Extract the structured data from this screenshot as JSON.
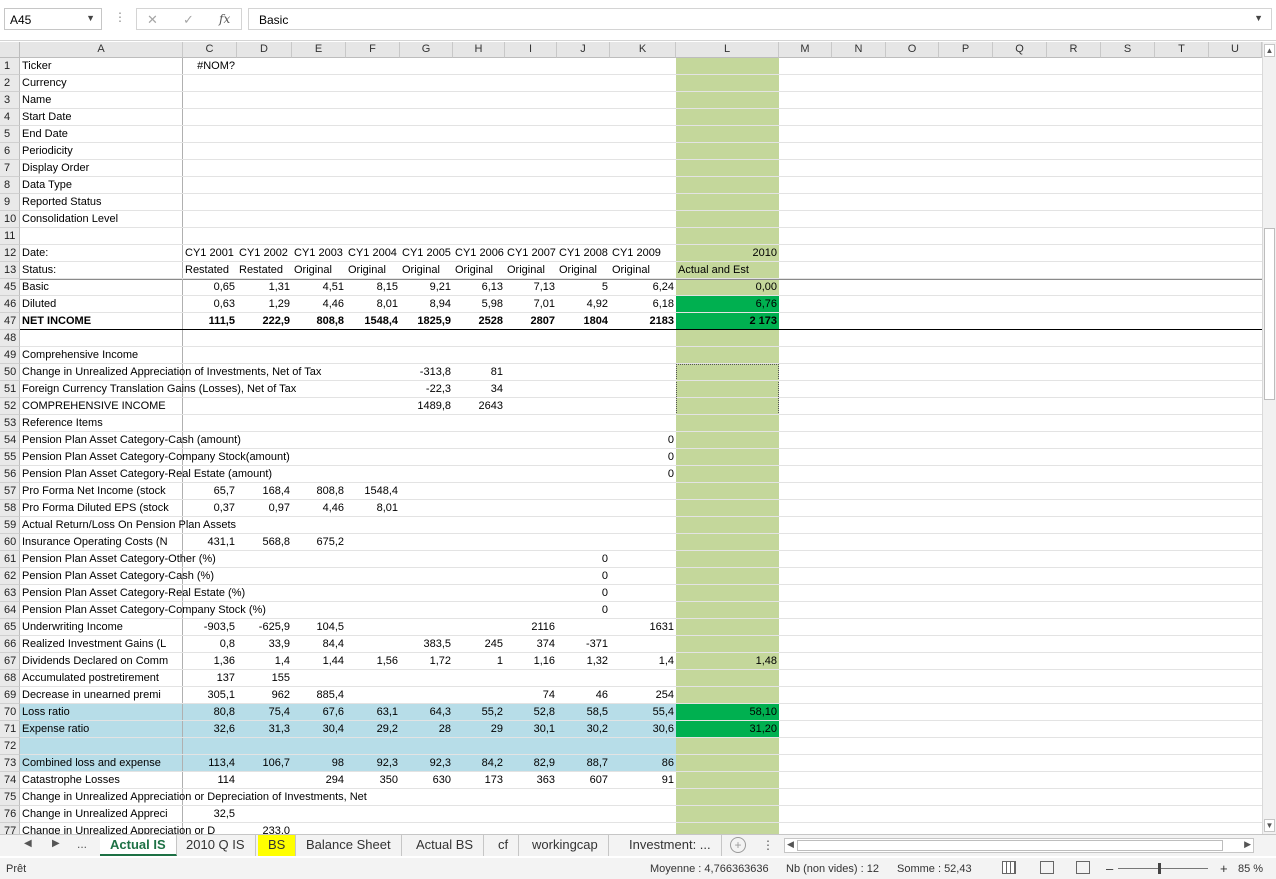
{
  "formula_bar": {
    "name_box": "A45",
    "content": "Basic",
    "fx": "fx",
    "cancel": "✕",
    "confirm": "✓"
  },
  "columns": [
    "A",
    "C",
    "D",
    "E",
    "F",
    "G",
    "H",
    "I",
    "J",
    "K",
    "L",
    "M",
    "N",
    "O",
    "P",
    "Q",
    "R",
    "S",
    "T",
    "U"
  ],
  "rows": [
    {
      "n": "1",
      "a": "Ticker",
      "cells": {
        "C": "#NOM?"
      }
    },
    {
      "n": "2",
      "a": "Currency",
      "cells": {}
    },
    {
      "n": "3",
      "a": "Name",
      "cells": {}
    },
    {
      "n": "4",
      "a": "Start Date",
      "cells": {}
    },
    {
      "n": "5",
      "a": "End Date",
      "cells": {}
    },
    {
      "n": "6",
      "a": "Periodicity",
      "cells": {}
    },
    {
      "n": "7",
      "a": "Display Order",
      "cells": {}
    },
    {
      "n": "8",
      "a": "Data Type",
      "cells": {}
    },
    {
      "n": "9",
      "a": "Reported Status",
      "cells": {}
    },
    {
      "n": "10",
      "a": "Consolidation Level",
      "cells": {}
    },
    {
      "n": "11",
      "a": "",
      "cells": {}
    },
    {
      "n": "12",
      "a": "Date:",
      "cells": {
        "C": "CY1 2001",
        "D": "CY1 2002",
        "E": "CY1 2003",
        "F": "CY1 2004",
        "G": "CY1 2005",
        "H": "CY1 2006",
        "I": "CY1 2007",
        "J": "CY1 2008",
        "K": "CY1 2009",
        "L": "2010"
      }
    },
    {
      "n": "13",
      "a": "Status:",
      "cells": {
        "C": "Restated",
        "D": "Restated",
        "E": "Original",
        "F": "Original",
        "G": "Original",
        "H": "Original",
        "I": "Original",
        "J": "Original",
        "K": "Original",
        "L": "Actual and Est"
      }
    },
    {
      "n": "45",
      "a": "Basic",
      "cells": {
        "C": "0,65",
        "D": "1,31",
        "E": "4,51",
        "F": "8,15",
        "G": "9,21",
        "H": "6,13",
        "I": "7,13",
        "J": "5",
        "K": "6,24",
        "L": "0,00"
      }
    },
    {
      "n": "46",
      "a": "Diluted",
      "cells": {
        "C": "0,63",
        "D": "1,29",
        "E": "4,46",
        "F": "8,01",
        "G": "8,94",
        "H": "5,98",
        "I": "7,01",
        "J": "4,92",
        "K": "6,18",
        "L": "6,76"
      }
    },
    {
      "n": "47",
      "a": "NET INCOME",
      "bold": true,
      "cells": {
        "C": "111,5",
        "D": "222,9",
        "E": "808,8",
        "F": "1548,4",
        "G": "1825,9",
        "H": "2528",
        "I": "2807",
        "J": "1804",
        "K": "2183",
        "L": "2 173"
      }
    },
    {
      "n": "48",
      "a": "",
      "cells": {}
    },
    {
      "n": "49",
      "a": "Comprehensive Income",
      "cells": {}
    },
    {
      "n": "50",
      "a": "Change in Unrealized Appreciation of Investments, Net of Tax",
      "cells": {
        "G": "-313,8",
        "H": "81"
      }
    },
    {
      "n": "51",
      "a": "Foreign Currency Translation Gains (Losses), Net of Tax",
      "cells": {
        "G": "-22,3",
        "H": "34"
      }
    },
    {
      "n": "52",
      "a": "COMPREHENSIVE INCOME",
      "cells": {
        "G": "1489,8",
        "H": "2643"
      }
    },
    {
      "n": "53",
      "a": "Reference Items",
      "cells": {}
    },
    {
      "n": "54",
      "a": "Pension Plan Asset Category-Cash (amount)",
      "cells": {
        "K": "0"
      }
    },
    {
      "n": "55",
      "a": "Pension Plan Asset Category-Company Stock(amount)",
      "cells": {
        "K": "0"
      }
    },
    {
      "n": "56",
      "a": "Pension Plan Asset Category-Real Estate (amount)",
      "cells": {
        "K": "0"
      }
    },
    {
      "n": "57",
      "a": "Pro Forma Net Income (stock",
      "cells": {
        "C": "65,7",
        "D": "168,4",
        "E": "808,8",
        "F": "1548,4"
      }
    },
    {
      "n": "58",
      "a": "Pro Forma Diluted EPS (stock",
      "cells": {
        "C": "0,37",
        "D": "0,97",
        "E": "4,46",
        "F": "8,01"
      }
    },
    {
      "n": "59",
      "a": "Actual Return/Loss On Pension Plan Assets",
      "cells": {}
    },
    {
      "n": "60",
      "a": "Insurance Operating Costs (N",
      "cells": {
        "C": "431,1",
        "D": "568,8",
        "E": "675,2"
      }
    },
    {
      "n": "61",
      "a": "Pension Plan Asset Category-Other (%)",
      "cells": {
        "J": "0"
      }
    },
    {
      "n": "62",
      "a": "Pension Plan Asset Category-Cash (%)",
      "cells": {
        "J": "0"
      }
    },
    {
      "n": "63",
      "a": "Pension Plan Asset Category-Real Estate (%)",
      "cells": {
        "J": "0"
      }
    },
    {
      "n": "64",
      "a": "Pension Plan Asset Category-Company Stock (%)",
      "cells": {
        "J": "0"
      }
    },
    {
      "n": "65",
      "a": "Underwriting Income",
      "cells": {
        "C": "-903,5",
        "D": "-625,9",
        "E": "104,5",
        "I": "2116",
        "K": "1631"
      }
    },
    {
      "n": "66",
      "a": "Realized Investment Gains (L",
      "cells": {
        "C": "0,8",
        "D": "33,9",
        "E": "84,4",
        "G": "383,5",
        "H": "245",
        "I": "374",
        "J": "-371"
      }
    },
    {
      "n": "67",
      "a": "Dividends Declared on Comm",
      "cells": {
        "C": "1,36",
        "D": "1,4",
        "E": "1,44",
        "F": "1,56",
        "G": "1,72",
        "H": "1",
        "I": "1,16",
        "J": "1,32",
        "K": "1,4",
        "L": "1,48"
      }
    },
    {
      "n": "68",
      "a": "Accumulated postretirement",
      "cells": {
        "C": "137",
        "D": "155"
      }
    },
    {
      "n": "69",
      "a": "Decrease in unearned premi",
      "cells": {
        "C": "305,1",
        "D": "962",
        "E": "885,4",
        "I": "74",
        "J": "46",
        "K": "254"
      }
    },
    {
      "n": "70",
      "a": "Loss ratio",
      "cells": {
        "C": "80,8",
        "D": "75,4",
        "E": "67,6",
        "F": "63,1",
        "G": "64,3",
        "H": "55,2",
        "I": "52,8",
        "J": "58,5",
        "K": "55,4",
        "L": "58,10"
      }
    },
    {
      "n": "71",
      "a": "Expense ratio",
      "cells": {
        "C": "32,6",
        "D": "31,3",
        "E": "30,4",
        "F": "29,2",
        "G": "28",
        "H": "29",
        "I": "30,1",
        "J": "30,2",
        "K": "30,6",
        "L": "31,20"
      }
    },
    {
      "n": "72",
      "a": "",
      "cells": {}
    },
    {
      "n": "73",
      "a": "Combined loss and expense",
      "cells": {
        "C": "113,4",
        "D": "106,7",
        "E": "98",
        "F": "92,3",
        "G": "92,3",
        "H": "84,2",
        "I": "82,9",
        "J": "88,7",
        "K": "86"
      }
    },
    {
      "n": "74",
      "a": "Catastrophe Losses",
      "cells": {
        "C": "114",
        "E": "294",
        "F": "350",
        "G": "630",
        "H": "173",
        "I": "363",
        "J": "607",
        "K": "91"
      }
    },
    {
      "n": "75",
      "a": "Change in Unrealized Appreciation or Depreciation of Investments, Net",
      "cells": {}
    },
    {
      "n": "76",
      "a": "Change in Unrealized Appreci",
      "cells": {
        "C": "32,5"
      }
    },
    {
      "n": "77",
      "a": "Change in Unrealized Appreciation or D",
      "cells": {
        "D": "233,0"
      }
    }
  ],
  "tabs": [
    {
      "label": "Actual IS",
      "state": "active"
    },
    {
      "label": "2010 Q IS",
      "state": ""
    },
    {
      "label": "BS",
      "state": "yellow"
    },
    {
      "label": "Balance Sheet",
      "state": ""
    },
    {
      "label": "Actual BS",
      "state": ""
    },
    {
      "label": "cf",
      "state": ""
    },
    {
      "label": "workingcap",
      "state": ""
    },
    {
      "label": "Investment: ...",
      "state": ""
    }
  ],
  "tab_nav": {
    "prev": "◀",
    "next": "▶",
    "more": "..."
  },
  "status": {
    "ready": "Prêt",
    "average": "Moyenne : 4,766363636",
    "count": "Nb (non vides) : 12",
    "sum": "Somme : 52,43",
    "zoom": "85 %"
  },
  "colors": {
    "accent_green": "#1e7145",
    "col_l_fill": "#c4d79b",
    "highlight_green": "#00b050",
    "band_blue": "#b7dde8",
    "tab_yellow": "#ffff00"
  }
}
